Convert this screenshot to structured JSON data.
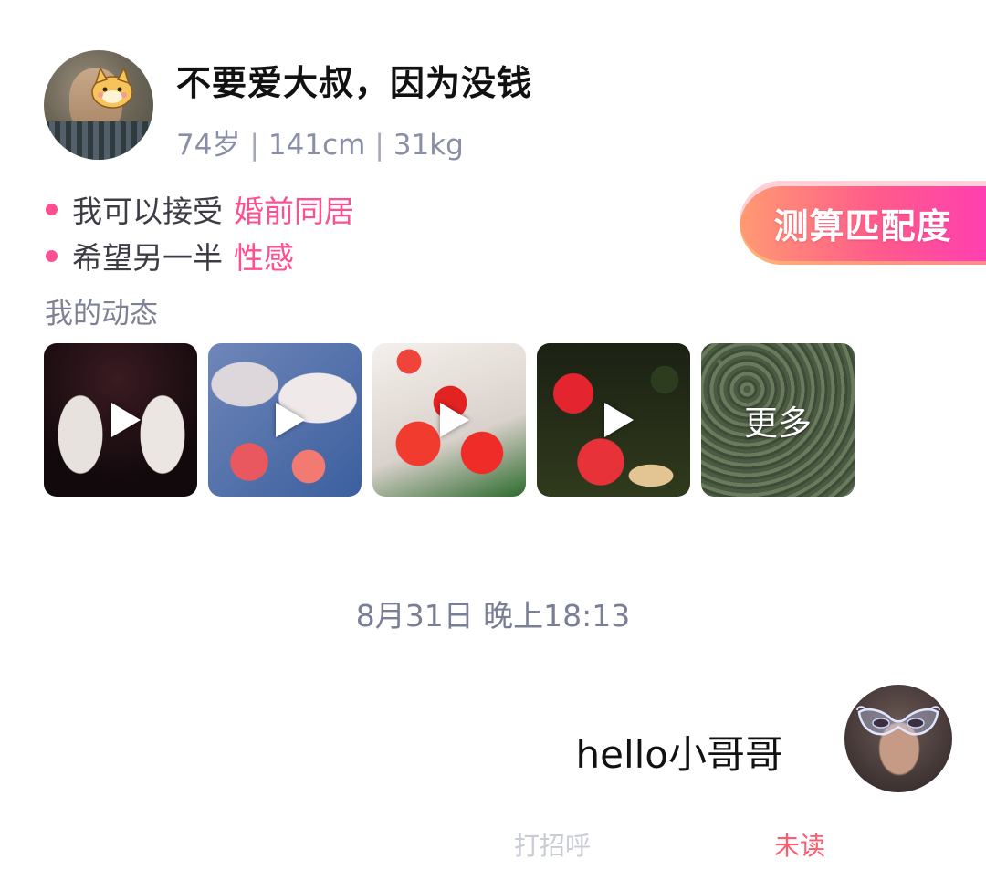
{
  "profile": {
    "nickname": "不要爱大叔，因为没钱",
    "age": "74岁",
    "height": "141cm",
    "weight": "31kg",
    "separator": "|"
  },
  "preferences": [
    {
      "label": "我可以接受",
      "value": "婚前同居"
    },
    {
      "label": "希望另一半",
      "value": "性感"
    }
  ],
  "match_button": {
    "label": "测算匹配度"
  },
  "moments": {
    "title": "我的动态",
    "more_label": "更多"
  },
  "chat": {
    "timestamp": "8月31日 晚上18:13",
    "message": "hello小哥哥",
    "greeting_tag": "打招呼",
    "read_status": "未读"
  },
  "colors": {
    "accent": "#ff4f90",
    "unread": "#ff5a6e"
  }
}
